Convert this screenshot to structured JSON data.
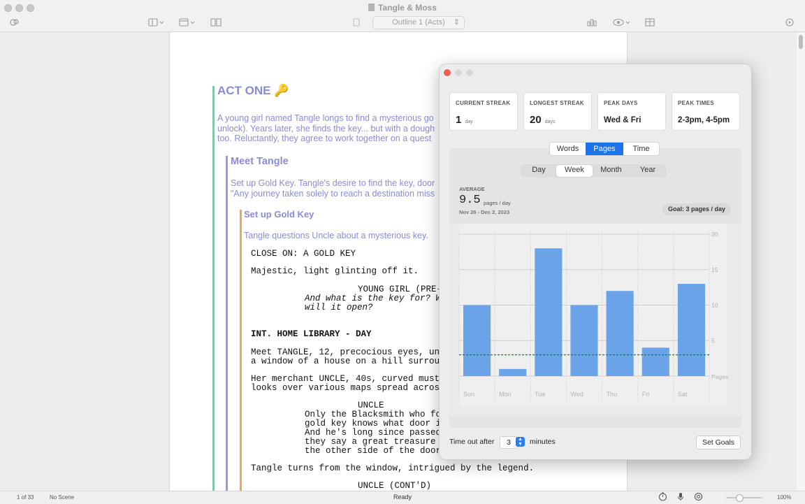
{
  "window": {
    "title": "Tangle & Moss",
    "outline_selector": "Outline 1 (Acts)"
  },
  "document": {
    "act_heading": "ACT ONE 🔑",
    "act_summary": [
      "A young girl named Tangle longs to find a mysterious go",
      "unlock). Years later, she finds the key... but with a dough",
      "too. Reluctantly, they agree to work together on a quest"
    ],
    "scene_heading": "Meet Tangle",
    "scene_summary": [
      "Set up Gold Key. Tangle's desire to find the key, door",
      "\"Any journey taken solely to reach a destination miss"
    ],
    "beat_heading": "Set up Gold Key",
    "beat_summary": "Tangle questions Uncle about a mysterious key.",
    "script": [
      {
        "text": "CLOSE ON: A GOLD KEY",
        "style": "action"
      },
      {
        "text": "Majestic, light glinting off it.",
        "style": "action"
      },
      {
        "text": "YOUNG GIRL (PRE-",
        "style": "character"
      },
      {
        "text": "And what is the key for? W",
        "style": "dialogue-i"
      },
      {
        "text": "will it open?",
        "style": "dialogue-i"
      },
      {
        "text": "INT. HOME LIBRARY - DAY",
        "style": "slug"
      },
      {
        "text": "Meet TANGLE, 12, precocious eyes, un",
        "style": "action"
      },
      {
        "text": "a window of a house on a hill surrou",
        "style": "action"
      },
      {
        "text": "Her merchant UNCLE, 40s, curved must",
        "style": "action"
      },
      {
        "text": "looks over various maps spread acros",
        "style": "action"
      },
      {
        "text": "UNCLE",
        "style": "character"
      },
      {
        "text": "Only the Blacksmith who fo",
        "style": "dialogue"
      },
      {
        "text": "gold key knows what door i",
        "style": "dialogue"
      },
      {
        "text": "And he's long since passed",
        "style": "dialogue"
      },
      {
        "text": "they say a great treasure",
        "style": "dialogue"
      },
      {
        "text": "the other side of the door",
        "style": "dialogue"
      },
      {
        "text": "Tangle turns from the window, intrigued by the legend.",
        "style": "action"
      },
      {
        "text": "UNCLE (CONT'D)",
        "style": "character"
      }
    ]
  },
  "stats_panel": {
    "cards": [
      {
        "label": "CURRENT STREAK",
        "value": "1",
        "unit": "day"
      },
      {
        "label": "LONGEST STREAK",
        "value": "20",
        "unit": "days"
      },
      {
        "label": "PEAK DAYS",
        "value": "Wed & Fri",
        "unit": ""
      },
      {
        "label": "PEAK TIMES",
        "value": "2-3pm, 4-5pm",
        "unit": ""
      }
    ],
    "metric_tabs": [
      "Words",
      "Pages",
      "Time"
    ],
    "metric_selected": "Pages",
    "period_tabs": [
      "Day",
      "Week",
      "Month",
      "Year"
    ],
    "period_selected": "Week",
    "average_label": "AVERAGE",
    "average_value": "9.5",
    "average_unit": "pages / day",
    "date_range": "Nov 26 - Dec 2, 2023",
    "goal_label": "Goal: 3 pages / day",
    "timeout_prefix": "Time out after",
    "timeout_value": "3",
    "timeout_suffix": "minutes",
    "set_goals_label": "Set Goals"
  },
  "chart_data": {
    "type": "bar",
    "categories": [
      "Sun",
      "Mon",
      "Tue",
      "Wed",
      "Thu",
      "Fri",
      "Sat"
    ],
    "values": [
      10,
      1,
      18,
      10,
      12,
      4,
      13
    ],
    "ylabel": "Pages",
    "ylim": [
      0,
      20
    ],
    "yticks": [
      5,
      10,
      15,
      20
    ],
    "goal_line": 3,
    "bar_color": "#6aa3e8",
    "goal_color": "#1e8a28",
    "grid": true
  },
  "statusbar": {
    "page_info": "1 of 33",
    "scene_info": "No Scene",
    "status": "Ready",
    "zoom": "100%"
  }
}
